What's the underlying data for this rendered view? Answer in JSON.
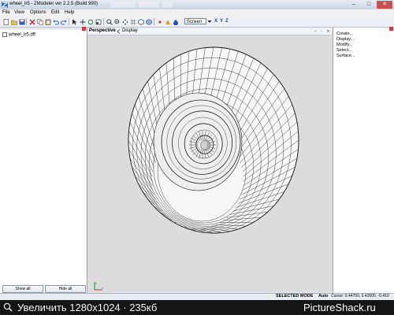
{
  "window": {
    "title": "wheel_lr5 - ZModeler ver 2.2.5 (Build 990)"
  },
  "menu": [
    "File",
    "View",
    "Options",
    "Edit",
    "Help"
  ],
  "toolbar": {
    "view_mode": "Screen",
    "axis_labels": [
      "X",
      "Y",
      "Z"
    ]
  },
  "left_panel": {
    "file_name": "wheel_lr5.dff",
    "show_all_label": "Show all",
    "hide_all_label": "Hide all"
  },
  "viewport": {
    "tabs": [
      "Perspective",
      "Display"
    ],
    "background_color": "#dcdcdc"
  },
  "right_panel": {
    "items": [
      "Create...",
      "Display...",
      "Modify...",
      "Select...",
      "Surface..."
    ]
  },
  "status": {
    "mode": "SELECTED MODE",
    "auto": "Auto",
    "cursor": "Cursor: 0.44750, 0.42600, -0.410"
  },
  "overlay": {
    "left_text": "Увеличить 1280x1024 · 235кб",
    "right_text": "PictureShack.ru"
  }
}
